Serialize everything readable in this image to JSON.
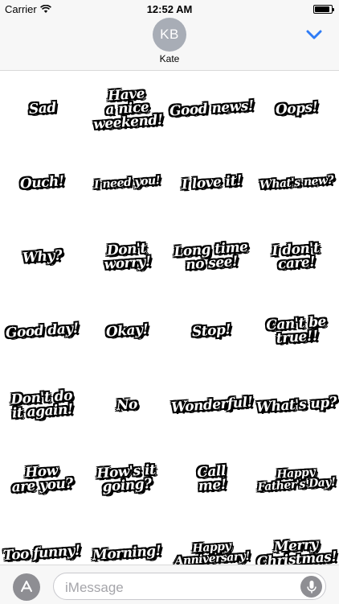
{
  "status_bar": {
    "carrier": "Carrier",
    "time": "12:52 AM",
    "battery_level": 0.9
  },
  "header": {
    "avatar_initials": "KB",
    "contact_name": "Kate",
    "collapse_icon": "chevron-down-icon",
    "accent_color": "#2f7cf6"
  },
  "stickers": [
    "Sad",
    "Have\na nice\nweekend!",
    "Good news!",
    "Oops!",
    "Ouch!",
    "I need you!",
    "I love it!",
    "What's new?",
    "Why?",
    "Don't\nworry!",
    "Long time\nno see!",
    "I don't\ncare!",
    "Good day!",
    "Okay!",
    "Stop!",
    "Can't be\ntrue!!",
    "Don't do\nit again!",
    "No",
    "Wonderful!",
    "What's up?",
    "How\nare you?",
    "How's it\ngoing?",
    "Call\nme!",
    "Happy\nFather's Day!",
    "Too funny!",
    "Morning!",
    "Happy\nAnniversary!",
    "Merry\nChristmas!"
  ],
  "input_bar": {
    "placeholder": "iMessage",
    "app_icon": "app-store-icon",
    "mic_icon": "microphone-icon"
  }
}
